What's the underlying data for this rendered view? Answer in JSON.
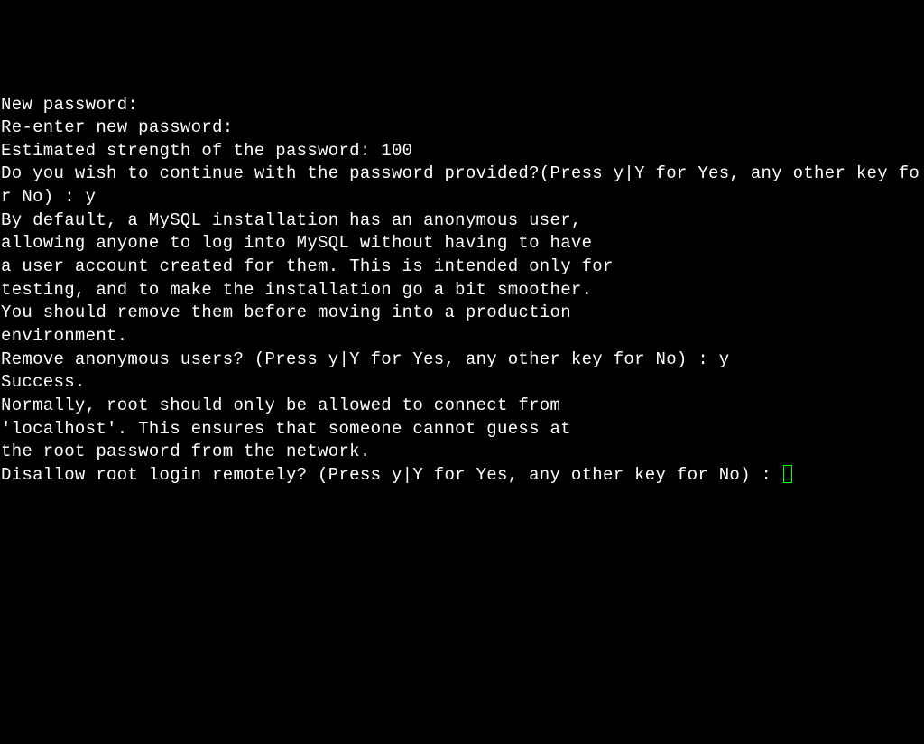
{
  "terminal": {
    "lines": [
      "New password:",
      "",
      "Re-enter new password:",
      "",
      "Estimated strength of the password: 100",
      "Do you wish to continue with the password provided?(Press y|Y for Yes, any other key for No) : y",
      "By default, a MySQL installation has an anonymous user,",
      "allowing anyone to log into MySQL without having to have",
      "a user account created for them. This is intended only for",
      "testing, and to make the installation go a bit smoother.",
      "You should remove them before moving into a production",
      "environment.",
      "",
      "Remove anonymous users? (Press y|Y for Yes, any other key for No) : y",
      "Success.",
      "",
      "",
      "Normally, root should only be allowed to connect from",
      "'localhost'. This ensures that someone cannot guess at",
      "the root password from the network.",
      ""
    ],
    "prompt_line": "Disallow root login remotely? (Press y|Y for Yes, any other key for No) : "
  }
}
